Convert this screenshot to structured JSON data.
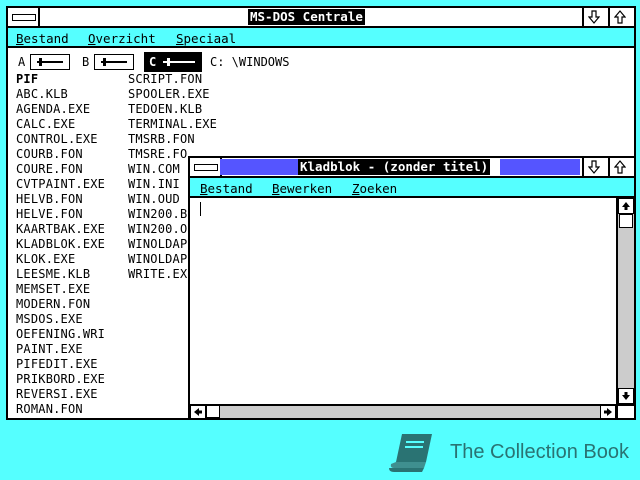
{
  "main_window": {
    "title": "MS-DOS Centrale",
    "menu": [
      "Bestand",
      "Overzicht",
      "Speciaal"
    ],
    "drives": [
      {
        "label": "A",
        "active": false
      },
      {
        "label": "B",
        "active": false
      },
      {
        "label": "C",
        "active": true
      }
    ],
    "current_path": "C: \\WINDOWS",
    "files_col1": [
      "PIF",
      "ABC.KLB",
      "AGENDA.EXE",
      "CALC.EXE",
      "CONTROL.EXE",
      "COURB.FON",
      "COURE.FON",
      "CVTPAINT.EXE",
      "HELVB.FON",
      "HELVE.FON",
      "KAARTBAK.EXE",
      "KLADBLOK.EXE",
      "KLOK.EXE",
      "LEESME.KLB",
      "MEMSET.EXE",
      "MODERN.FON",
      "MSDOS.EXE",
      "OEFENING.WRI",
      "PAINT.EXE",
      "PIFEDIT.EXE",
      "PRIKBORD.EXE",
      "REVERSI.EXE",
      "ROMAN.FON"
    ],
    "files_col2": [
      "SCRIPT.FON",
      "SPOOLER.EXE",
      "TEDOEN.KLB",
      "TERMINAL.EXE",
      "TMSRB.FON",
      "TMSRE.FO",
      "WIN.COM",
      "WIN.INI",
      "WIN.OUD",
      "WIN200.B",
      "WIN200.O",
      "WINOLDAP",
      "WINOLDAP",
      "WRITE.EX"
    ]
  },
  "notepad_window": {
    "title": "Kladblok - (zonder titel)",
    "menu": [
      "Bestand",
      "Bewerken",
      "Zoeken"
    ]
  },
  "branding": {
    "text": "The Collection Book",
    "icon": "book-icon",
    "color": "#2a7373"
  },
  "colors": {
    "desktop": "#55ffff",
    "title_fill": "#5555ff",
    "menu_bg": "#55ffff"
  }
}
